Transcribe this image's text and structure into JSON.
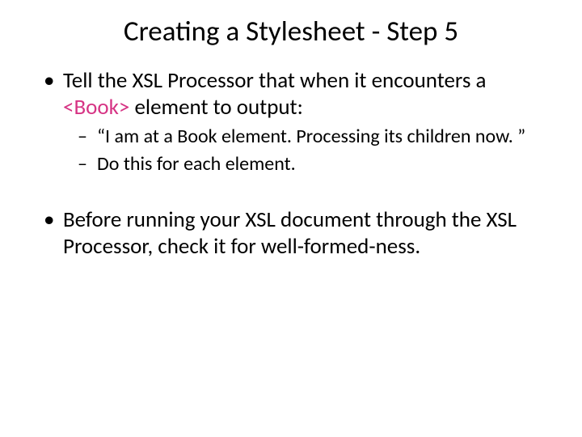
{
  "title": "Creating a Stylesheet - Step 5",
  "bullets": {
    "b1_pre": "Tell the XSL Processor that when it encounters a ",
    "b1_code": "<Book>",
    "b1_post": " element to output:",
    "b1_sub1": "“I am at a Book element.  Processing its children now. ”",
    "b1_sub2": "Do this for each element.",
    "b2": "Before running your XSL document through the XSL Processor, check it for well-formed-ness."
  }
}
